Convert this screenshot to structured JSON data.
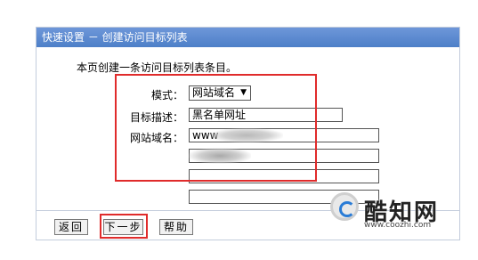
{
  "title_bar": {
    "text": "快速设置 － 创建访问目标列表"
  },
  "description": "本页创建一条访问目标列表条目。",
  "form": {
    "mode_label": "模式：",
    "mode_value": "网站域名",
    "target_desc_label": "目标描述：",
    "target_desc_value": "黑名单网址",
    "domain_label": "网站域名：",
    "domain_values": [
      "www",
      "",
      "",
      ""
    ]
  },
  "buttons": {
    "back": "返回",
    "next": "下一步",
    "help": "帮助"
  },
  "watermark": {
    "title": "酷知网",
    "url": "www.coozhi.com"
  },
  "colors": {
    "title_bar": "#5b8ad0",
    "highlight": "#e02b2b"
  }
}
